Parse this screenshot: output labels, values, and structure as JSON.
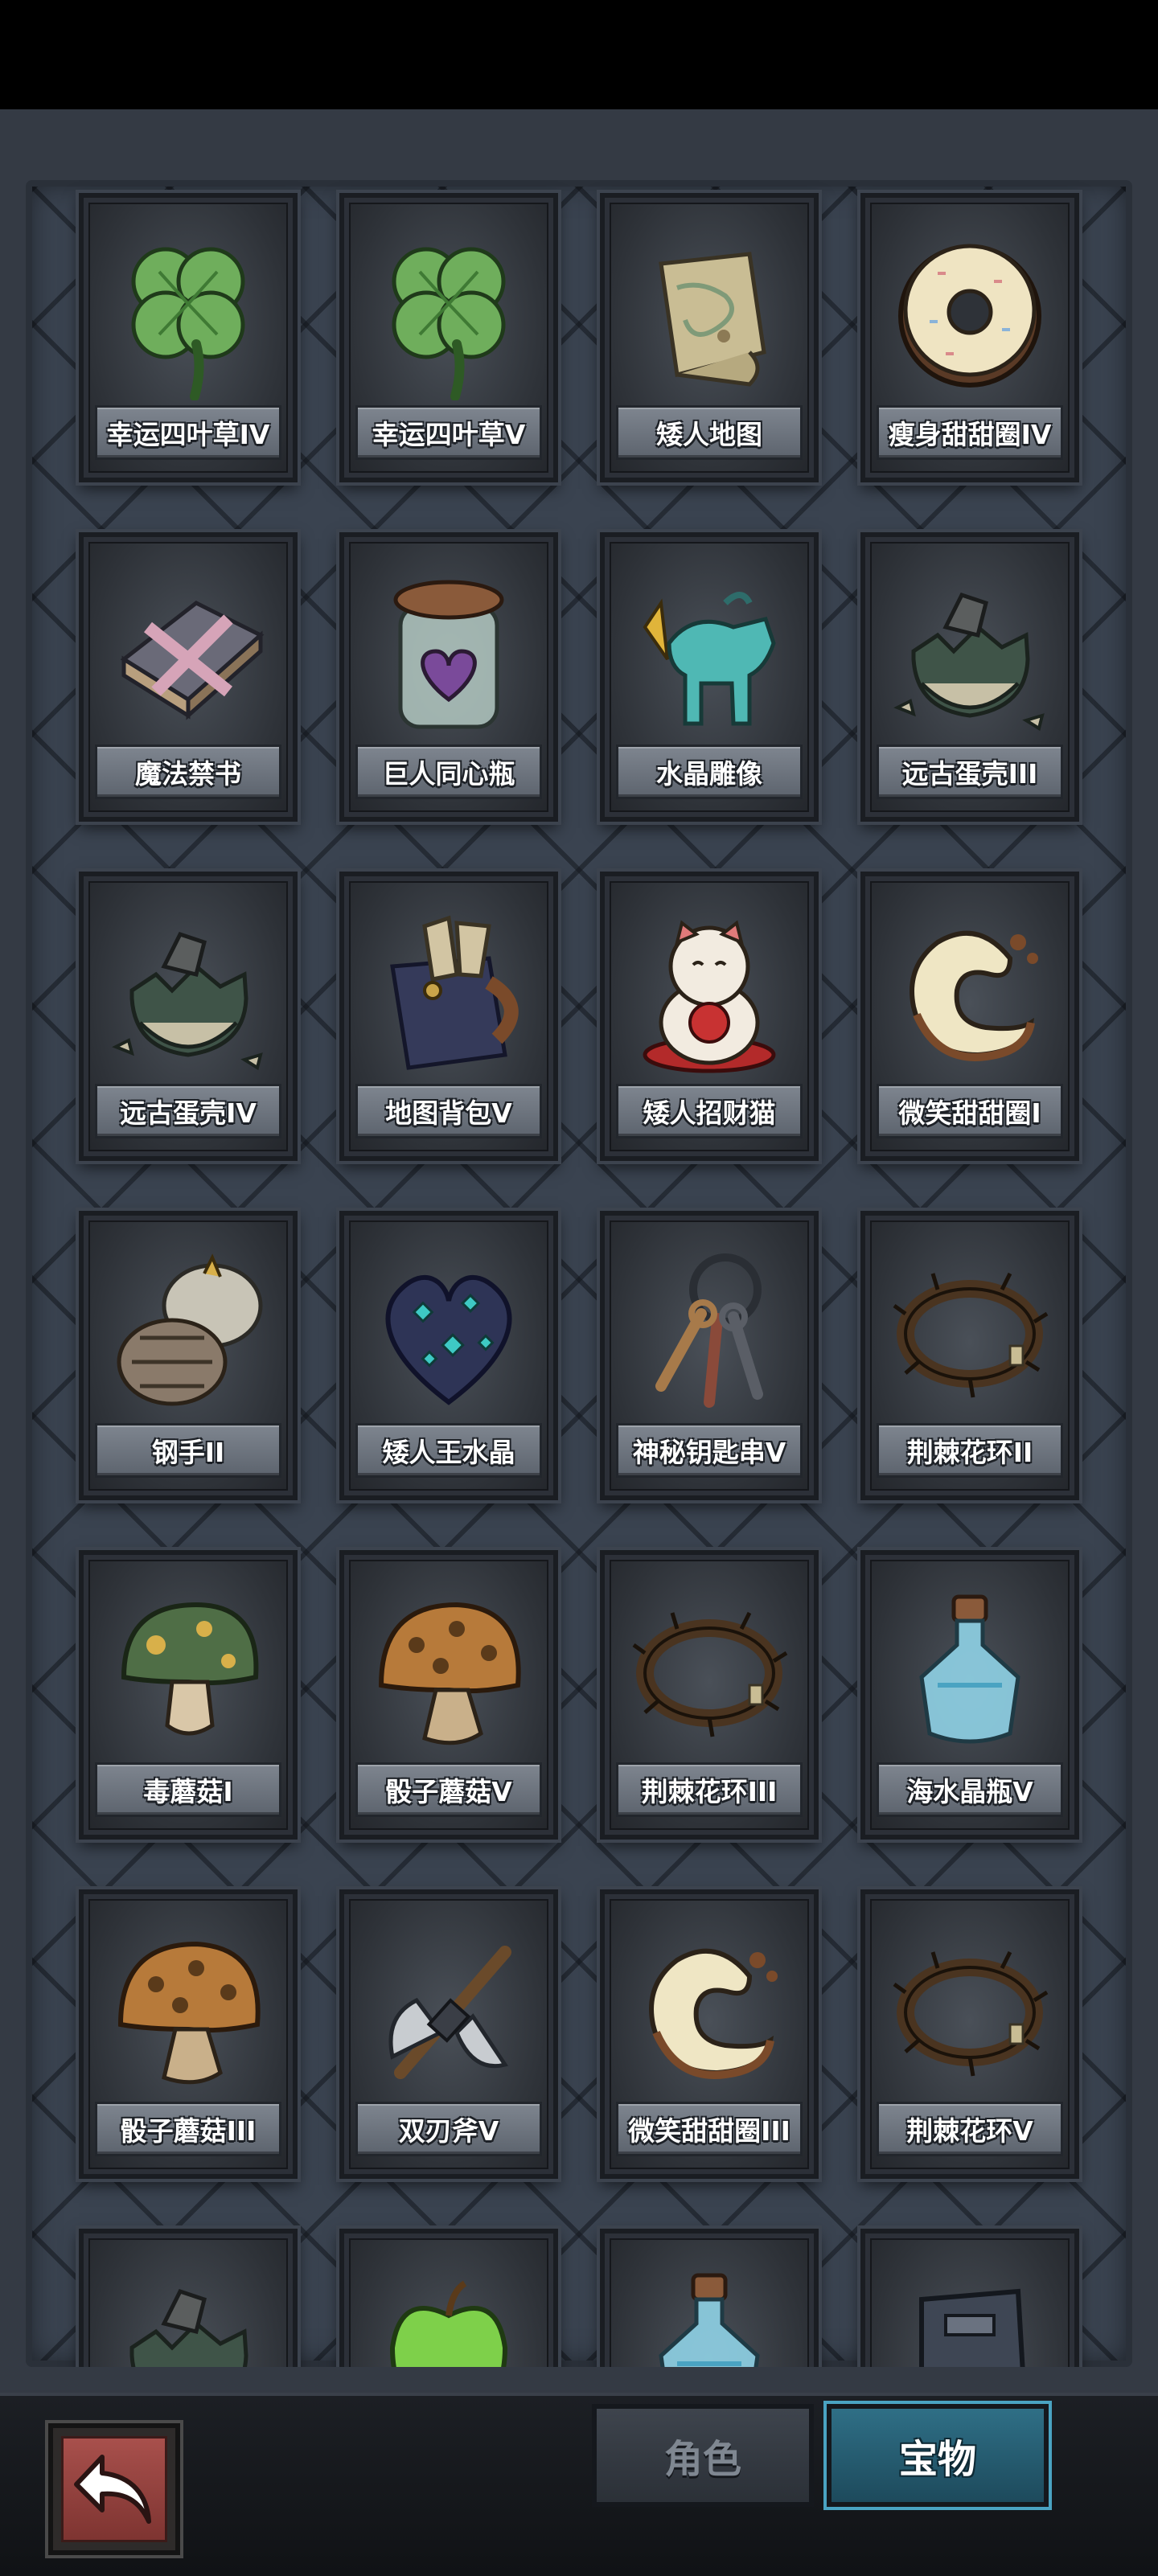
{
  "items": [
    {
      "label": "幸运四叶草IV",
      "icon": "four-leaf-clover"
    },
    {
      "label": "幸运四叶草V",
      "icon": "four-leaf-clover"
    },
    {
      "label": "矮人地图",
      "icon": "scroll-map"
    },
    {
      "label": "瘦身甜甜圈IV",
      "icon": "donut"
    },
    {
      "label": "魔法禁书",
      "icon": "chained-book"
    },
    {
      "label": "巨人同心瓶",
      "icon": "jar-heart"
    },
    {
      "label": "水晶雕像",
      "icon": "crystal-statue"
    },
    {
      "label": "远古蛋壳III",
      "icon": "eggshell"
    },
    {
      "label": "远古蛋壳IV",
      "icon": "eggshell"
    },
    {
      "label": "地图背包V",
      "icon": "map-backpack"
    },
    {
      "label": "矮人招财猫",
      "icon": "lucky-cat"
    },
    {
      "label": "微笑甜甜圈I",
      "icon": "smile-donut"
    },
    {
      "label": "钢手II",
      "icon": "steel-gauntlet"
    },
    {
      "label": "矮人王水晶",
      "icon": "crystal-heart"
    },
    {
      "label": "神秘钥匙串V",
      "icon": "key-ring"
    },
    {
      "label": "荆棘花环II",
      "icon": "thorn-wreath"
    },
    {
      "label": "毒蘑菇I",
      "icon": "poison-mushroom"
    },
    {
      "label": "骰子蘑菇V",
      "icon": "dice-mushroom"
    },
    {
      "label": "荆棘花环III",
      "icon": "thorn-wreath"
    },
    {
      "label": "海水晶瓶V",
      "icon": "potion-bottle"
    },
    {
      "label": "骰子蘑菇III",
      "icon": "dice-mushroom"
    },
    {
      "label": "双刃斧V",
      "icon": "double-axe"
    },
    {
      "label": "微笑甜甜圈III",
      "icon": "smile-donut"
    },
    {
      "label": "荆棘花环V",
      "icon": "thorn-wreath"
    },
    {
      "label": "",
      "icon": "eggshell"
    },
    {
      "label": "",
      "icon": "green-apple"
    },
    {
      "label": "",
      "icon": "potion-bottle"
    },
    {
      "label": "",
      "icon": "iron-box"
    }
  ],
  "tabs": {
    "role": "角色",
    "treasure": "宝物"
  },
  "active_tab": "treasure",
  "back_icon": "back-arrow-icon"
}
